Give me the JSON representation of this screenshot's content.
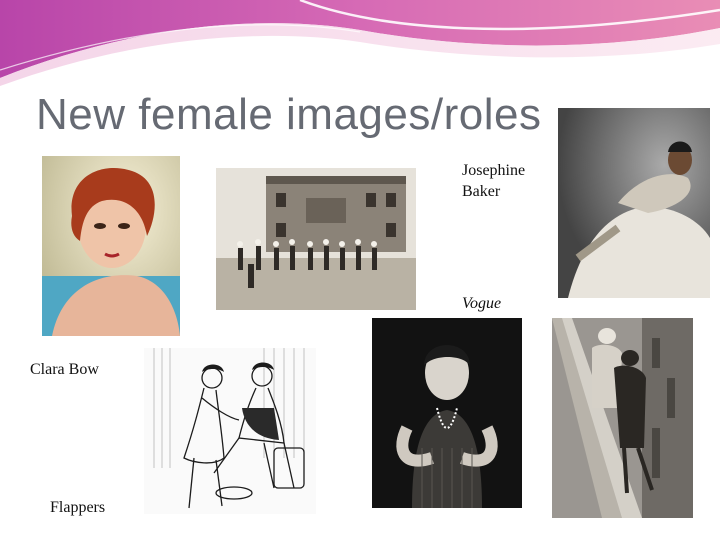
{
  "slide": {
    "title": "New female images/roles",
    "captions": {
      "josephine_line1": "Josephine",
      "josephine_line2": "Baker",
      "vogue": "Vogue",
      "clara_bow": "Clara Bow",
      "flappers": "Flappers"
    }
  },
  "colors": {
    "wave_top": "#c04fb0",
    "wave_mid": "#e27fb6",
    "wave_light": "#f6d8e8",
    "title": "#666a73"
  },
  "photos": [
    {
      "id": "clara-bow-portrait",
      "tone": "color"
    },
    {
      "id": "schoolyard-exercise",
      "tone": "sepia"
    },
    {
      "id": "josephine-baker",
      "tone": "bw"
    },
    {
      "id": "flapper-fringe-dress",
      "tone": "bw"
    },
    {
      "id": "flappers-rooftop",
      "tone": "bw"
    },
    {
      "id": "flappers-sketch",
      "tone": "line-art"
    }
  ]
}
